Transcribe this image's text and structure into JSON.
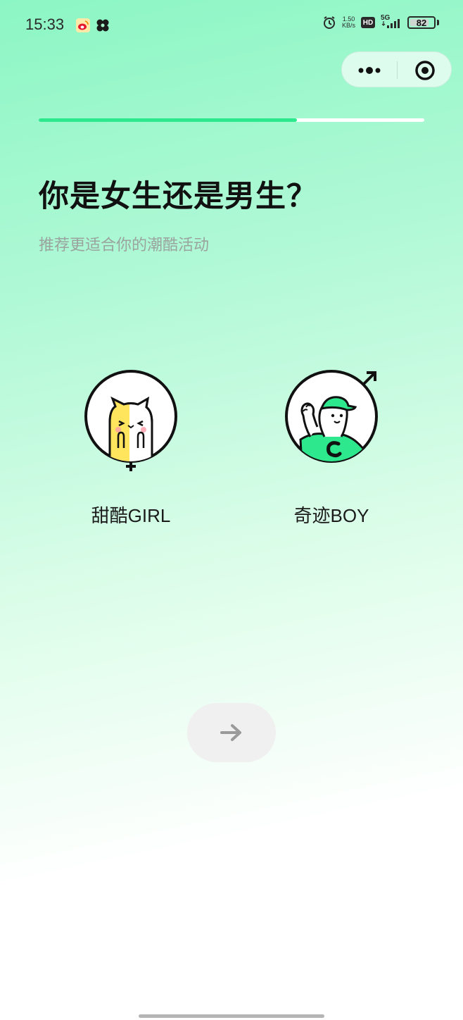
{
  "status_bar": {
    "time": "15:33",
    "net_speed_value": "1.50",
    "net_speed_unit": "KB/s",
    "hd_label": "HD",
    "network_label": "5G",
    "battery_level": "82",
    "battery_fraction": 0.82,
    "icons": [
      "weibo-icon",
      "flower-icon",
      "alarm-icon",
      "signal-icon",
      "battery-icon"
    ]
  },
  "capsule": {
    "more_icon": "more-dots-icon",
    "close_icon": "target-circle-icon"
  },
  "progress": {
    "fraction": 0.67,
    "fill_color": "#2ee88e"
  },
  "question": {
    "title": "你是女生还是男生？",
    "subtitle": "推荐更适合你的潮酷活动"
  },
  "options": [
    {
      "label": "甜酷GIRL",
      "icon": "cat-avatar-female-icon"
    },
    {
      "label": "奇迹BOY",
      "icon": "waving-character-male-icon",
      "accent": "#2ee88e"
    }
  ],
  "next_button": {
    "icon": "arrow-right-icon",
    "background": "#f0f0f0"
  }
}
